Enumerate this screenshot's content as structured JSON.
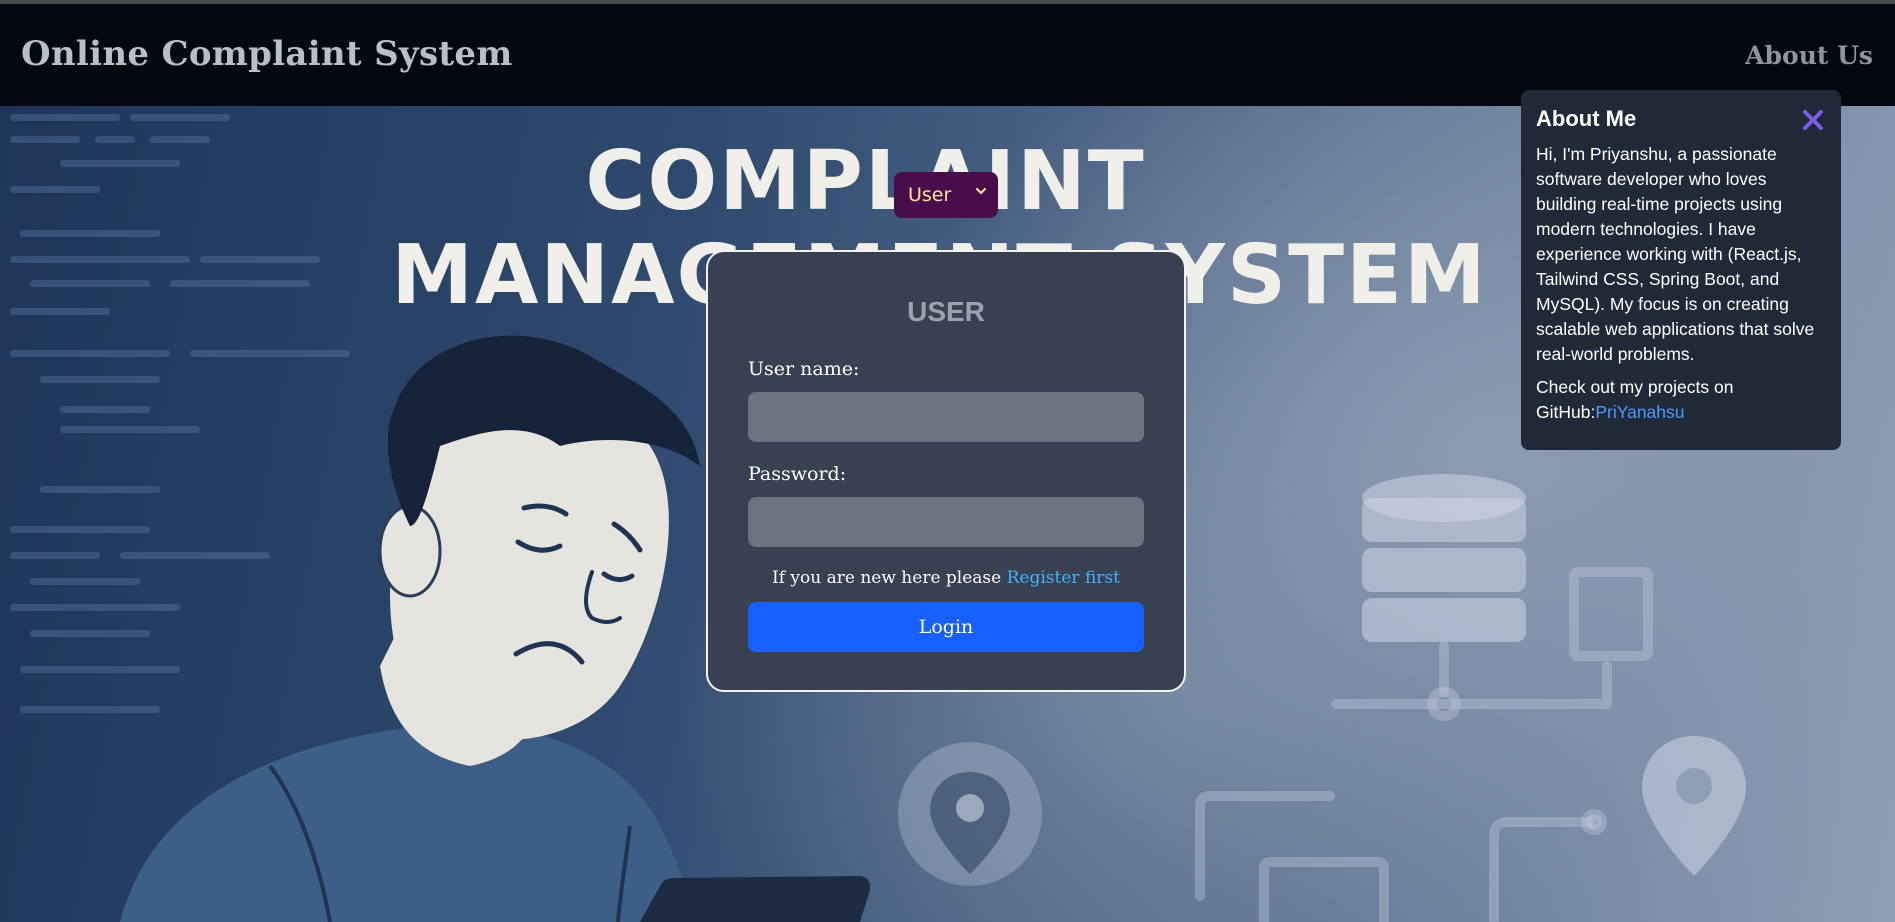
{
  "header": {
    "brand": "Online Complaint System",
    "about_link": "About Us"
  },
  "hero": {
    "title_line1": "COMPLAINT",
    "title_line2": "MANAGEMENT SYSTEM"
  },
  "role_select": {
    "value": "User",
    "icon": "chevron-down-icon"
  },
  "login_card": {
    "title": "USER",
    "username_label": "User name:",
    "username_value": "",
    "password_label": "Password:",
    "password_value": "",
    "register_prefix": "If you are new here please",
    "register_link": "Register first",
    "login_button": "Login"
  },
  "about_popup": {
    "title": "About Me",
    "close_icon": "close-icon",
    "bio": "Hi, I'm Priyanshu, a passionate software developer who loves building real-time projects using modern technologies. I have experience working with (React.js, Tailwind CSS, Spring Boot, and MySQL). My focus is on creating scalable web applications that solve real-world problems.",
    "github_prefix": "Check out my projects on GitHub:",
    "github_link": "PriYanahsu"
  },
  "colors": {
    "header_bg": "#020712",
    "card_bg": "#374152",
    "login_button": "#1760ff",
    "link": "#3eb3ff",
    "select_bg": "#4a0d4c",
    "popup_bg": "#1f2937",
    "close_icon": "#7c5ce6"
  }
}
